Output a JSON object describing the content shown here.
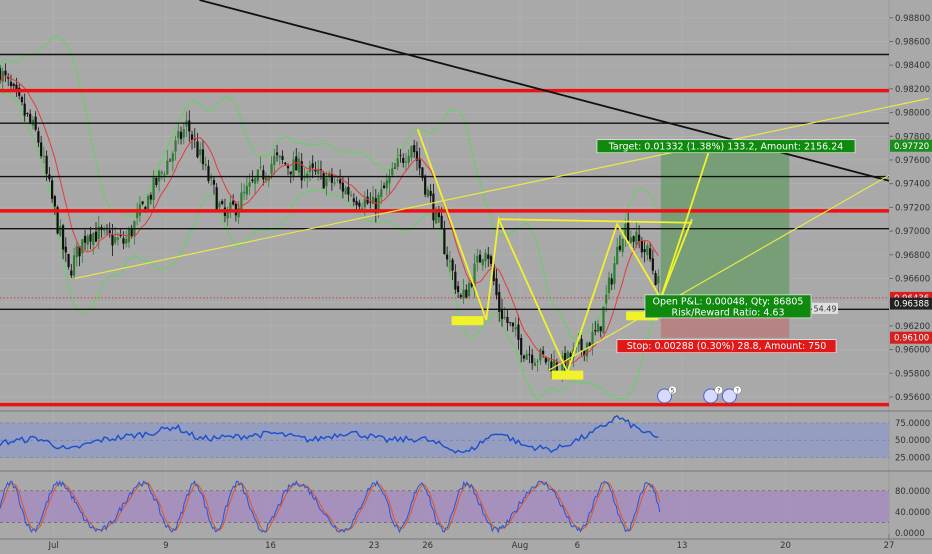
{
  "chart_data": {
    "type": "candlestick",
    "price_axis": {
      "ylim": [
        0.9549,
        0.9895
      ],
      "ticks": [
        0.988,
        0.986,
        0.984,
        0.982,
        0.98,
        0.978,
        0.976,
        0.974,
        0.972,
        0.97,
        0.968,
        0.966,
        0.964,
        0.962,
        0.96,
        0.958,
        0.956
      ],
      "tick_labels": [
        "0.98800",
        "0.98600",
        "0.98400",
        "0.98200",
        "0.98000",
        "0.97800",
        "0.97600",
        "0.97400",
        "0.97200",
        "0.97000",
        "0.96800",
        "0.96600",
        "0.96400",
        "0.96200",
        "0.96000",
        "0.95800",
        "0.95600"
      ],
      "markers": [
        {
          "value": 0.9772,
          "label": "0.97720",
          "color": "#1e8c1e"
        },
        {
          "value": 0.96436,
          "label": "0.96436",
          "color": "#d42020"
        },
        {
          "value": 0.96388,
          "label": "0.96388",
          "color": "#222222"
        },
        {
          "value": 0.961,
          "label": "0.96100",
          "color": "#d42020"
        }
      ]
    },
    "time_axis": {
      "labels": [
        {
          "t": 4.3,
          "label": "Jul"
        },
        {
          "t": 13.3,
          "label": "9"
        },
        {
          "t": 21.7,
          "label": "16"
        },
        {
          "t": 30,
          "label": "23"
        },
        {
          "t": 34.3,
          "label": "26"
        },
        {
          "t": 41.7,
          "label": "Aug"
        },
        {
          "t": 46.3,
          "label": "6"
        },
        {
          "t": 54.7,
          "label": "13"
        },
        {
          "t": 63,
          "label": "20"
        },
        {
          "t": 71.3,
          "label": "27"
        }
      ],
      "t_range": [
        0,
        71.3
      ]
    },
    "price_path": [
      [
        0,
        0.9835
      ],
      [
        3,
        0.978
      ],
      [
        5.5,
        0.9665
      ],
      [
        7,
        0.97
      ],
      [
        10,
        0.969
      ],
      [
        12.5,
        0.974
      ],
      [
        15,
        0.979
      ],
      [
        16.5,
        0.975
      ],
      [
        18,
        0.971
      ],
      [
        22,
        0.976
      ],
      [
        27,
        0.974
      ],
      [
        30,
        0.972
      ],
      [
        33,
        0.9775
      ],
      [
        35,
        0.971
      ],
      [
        37,
        0.964
      ],
      [
        39,
        0.969
      ],
      [
        40,
        0.9635
      ],
      [
        42,
        0.96
      ],
      [
        45,
        0.9585
      ],
      [
        48,
        0.9615
      ],
      [
        50,
        0.9705
      ],
      [
        52,
        0.968
      ],
      [
        53,
        0.9648
      ]
    ],
    "horizontal_levels": [
      {
        "value": 0.9849,
        "color": "#111111",
        "width": 1.4
      },
      {
        "value": 0.98185,
        "color": "#ee1111",
        "width": 3.5
      },
      {
        "value": 0.9791,
        "color": "#111111",
        "width": 1.4
      },
      {
        "value": 0.9746,
        "color": "#111111",
        "width": 1.4
      },
      {
        "value": 0.9717,
        "color": "#ee1111",
        "width": 3.5
      },
      {
        "value": 0.9702,
        "color": "#111111",
        "width": 1.4
      },
      {
        "value": 0.9634,
        "color": "#111111",
        "width": 1.4
      },
      {
        "value": 0.95535,
        "color": "#ee1111",
        "width": 3.5
      }
    ],
    "dotted_levels": [
      {
        "value": 0.96436,
        "color": "#d42020"
      }
    ],
    "trend_lines": [
      {
        "from": [
          16,
          0.9895
        ],
        "to": [
          71.3,
          0.97425
        ],
        "color": "#111111",
        "width": 1.8
      },
      {
        "from": [
          6,
          0.966
        ],
        "to": [
          74.5,
          0.9812
        ],
        "color": "#e8e84a",
        "width": 1.2
      },
      {
        "from": [
          44,
          0.95825
        ],
        "to": [
          71.3,
          0.9747
        ],
        "color": "#e8e84a",
        "width": 1.2
      }
    ],
    "harmonic_pattern": {
      "points": [
        [
          33.5,
          0.9786
        ],
        [
          39,
          0.9625
        ],
        [
          40,
          0.971
        ],
        [
          45.5,
          0.9581
        ],
        [
          49.5,
          0.9706
        ],
        [
          53,
          0.9643
        ],
        [
          55.5,
          0.971
        ]
      ],
      "extra_lines": [
        [
          [
            40,
            0.971
          ],
          [
            55.5,
            0.9707
          ]
        ]
      ],
      "color": "#f2f22a",
      "labels": [
        {
          "text": "",
          "t": 37.5,
          "value": 0.9624
        },
        {
          "text": "",
          "t": 45.5,
          "value": 0.9578
        },
        {
          "text": "",
          "t": 51.5,
          "value": 0.9628
        }
      ]
    },
    "position": {
      "t_start": 53,
      "t_end": 63.3,
      "entry": 0.96436,
      "target": 0.9772,
      "stop": 0.961,
      "path_end_t": 57,
      "target_label": "Target: 0.01332 (1.38%) 133.2, Amount: 2156.24",
      "stop_label": "Stop: 0.00288 (0.30%) 28.8, Amount: 750",
      "open_label_line1": "Open P&L: 0.00048, Qty: 86805",
      "open_label_line2": "Risk/Reward Ratio: 4.63",
      "small_badge": "54.49"
    },
    "event_markers": [
      {
        "t": 53.3,
        "badge": "5"
      },
      {
        "t": 57,
        "badge": "?"
      },
      {
        "t": 58.5,
        "badge": "?"
      }
    ],
    "rsi": {
      "levels": [
        75,
        50,
        25
      ],
      "tick_labels": [
        "75.0000",
        "50.0000",
        "25.0000"
      ],
      "band": [
        25,
        75
      ],
      "ylim": [
        14,
        88
      ],
      "path": [
        [
          0,
          46
        ],
        [
          3,
          53
        ],
        [
          5.5,
          35
        ],
        [
          8,
          50
        ],
        [
          12,
          60
        ],
        [
          14,
          70
        ],
        [
          16,
          52
        ],
        [
          19,
          55
        ],
        [
          22,
          60
        ],
        [
          25,
          50
        ],
        [
          28,
          62
        ],
        [
          31,
          50
        ],
        [
          34,
          52
        ],
        [
          36,
          38
        ],
        [
          37.5,
          32
        ],
        [
          39,
          52
        ],
        [
          40,
          62
        ],
        [
          42,
          42
        ],
        [
          44.5,
          36
        ],
        [
          47.5,
          60
        ],
        [
          49.5,
          84
        ],
        [
          51,
          68
        ],
        [
          53,
          50
        ]
      ],
      "color": "#1a4fcf"
    },
    "stoch": {
      "levels": [
        80,
        40,
        0
      ],
      "tick_labels": [
        "80.0000",
        "40.0000",
        "0.0000"
      ],
      "dashed": [
        80,
        20
      ],
      "ylim": [
        -2,
        112
      ],
      "k_color": "#3356d8",
      "d_color": "#e05a28"
    },
    "xlabel": "",
    "ylabel": ""
  }
}
